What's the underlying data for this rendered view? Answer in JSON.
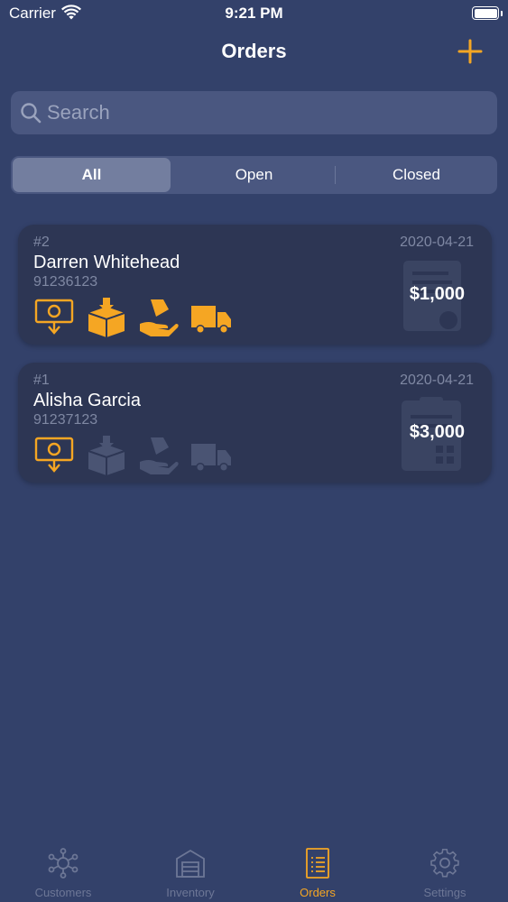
{
  "status_bar": {
    "carrier": "Carrier",
    "time": "9:21 PM"
  },
  "header": {
    "title": "Orders",
    "add_icon": "plus-icon"
  },
  "search": {
    "placeholder": "Search",
    "icon": "search-icon"
  },
  "filter": {
    "segments": [
      "All",
      "Open",
      "Closed"
    ],
    "selected": "All"
  },
  "orders": [
    {
      "number": "#2",
      "date": "2020-04-21",
      "customer": "Darren Whitehead",
      "phone": "91236123",
      "amount": "$1,000",
      "statuses": [
        {
          "icon": "payment-icon",
          "done": true
        },
        {
          "icon": "box-icon",
          "done": true
        },
        {
          "icon": "hand-delivery-icon",
          "done": true
        },
        {
          "icon": "truck-icon",
          "done": true
        }
      ]
    },
    {
      "number": "#1",
      "date": "2020-04-21",
      "customer": "Alisha Garcia",
      "phone": "91237123",
      "amount": "$3,000",
      "statuses": [
        {
          "icon": "payment-icon",
          "done": true
        },
        {
          "icon": "box-icon",
          "done": false
        },
        {
          "icon": "hand-delivery-icon",
          "done": false
        },
        {
          "icon": "truck-icon",
          "done": false
        }
      ]
    }
  ],
  "tabs": [
    {
      "label": "Customers",
      "icon": "customers-network-icon"
    },
    {
      "label": "Inventory",
      "icon": "warehouse-icon"
    },
    {
      "label": "Orders",
      "icon": "orders-list-icon"
    },
    {
      "label": "Settings",
      "icon": "gear-icon"
    }
  ],
  "active_tab": "Orders",
  "colors": {
    "background": "#33416a",
    "card": "#2d3654",
    "accent": "#f5a623",
    "inactive_icon": "#4a5473",
    "muted_text": "#7f88a3"
  }
}
